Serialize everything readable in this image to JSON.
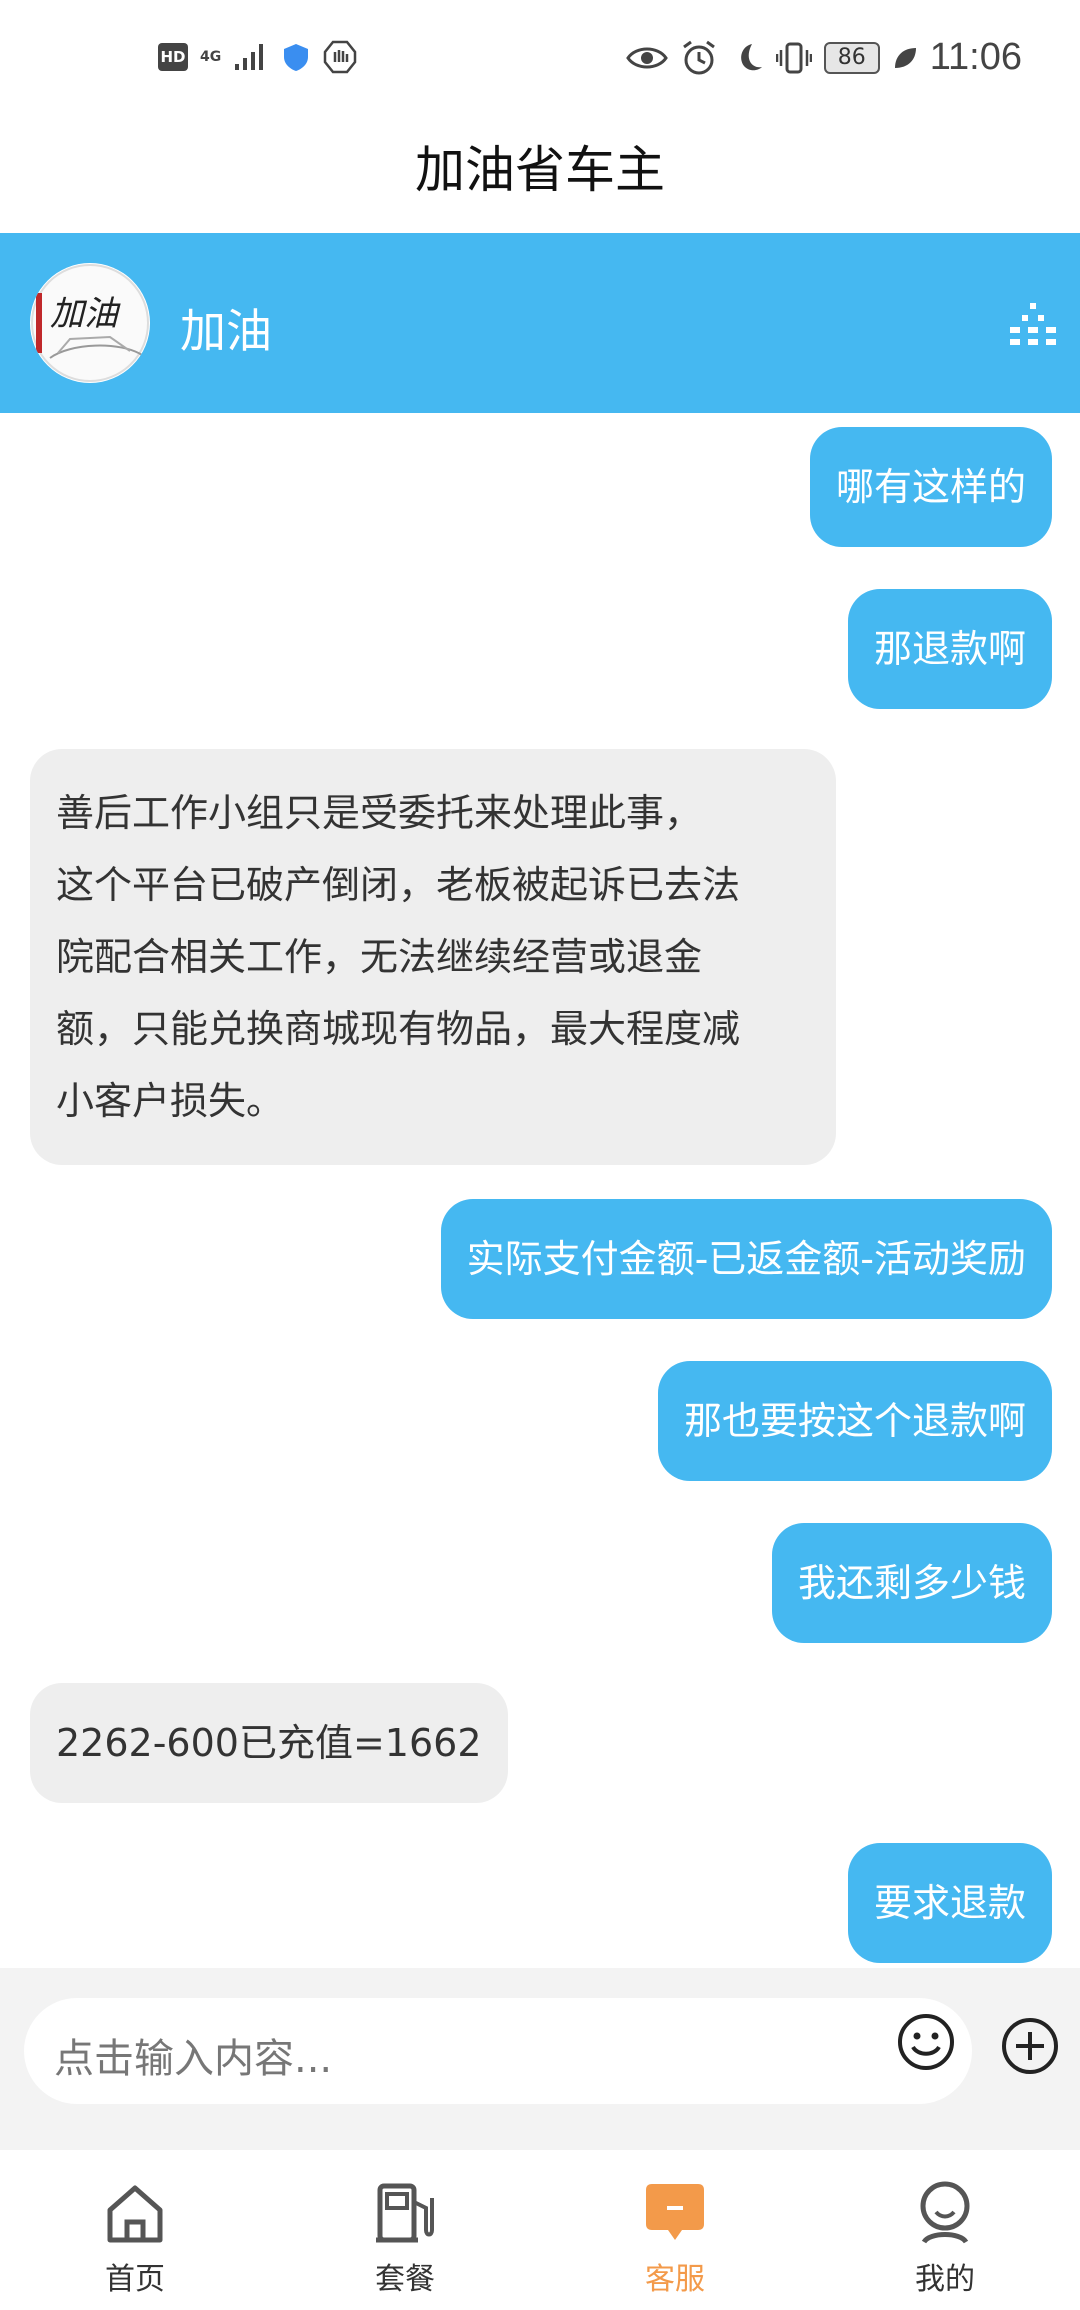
{
  "status_bar": {
    "hd": "HD",
    "network": "4G",
    "battery": "86",
    "time": "11:06"
  },
  "app": {
    "title": "加油省车主"
  },
  "chat_header": {
    "name": "加油",
    "avatar_text": "加油"
  },
  "messages": [
    {
      "side": "out",
      "text": "哪有这样的"
    },
    {
      "side": "out",
      "text": "那退款啊"
    },
    {
      "side": "in",
      "lines": [
        "善后工作小组只是受委托来处理此事，",
        "这个平台已破产倒闭，老板被起诉已去法",
        "院配合相关工作，无法继续经营或退金",
        "额，只能兑换商城现有物品，最大程度减",
        "小客户损失。"
      ]
    },
    {
      "side": "out",
      "text": "实际支付金额-已返金额-活动奖励"
    },
    {
      "side": "out",
      "text": "那也要按这个退款啊"
    },
    {
      "side": "out",
      "text": "我还剩多少钱"
    },
    {
      "side": "in",
      "text": "2262-600已充值=1662"
    },
    {
      "side": "out",
      "text": "要求退款"
    }
  ],
  "input": {
    "placeholder": "点击输入内容..."
  },
  "bottom_nav": {
    "items": [
      {
        "label": "首页",
        "icon": "home-icon"
      },
      {
        "label": "套餐",
        "icon": "fuel-pump-icon"
      },
      {
        "label": "客服",
        "icon": "chat-icon"
      },
      {
        "label": "我的",
        "icon": "profile-icon"
      }
    ],
    "active": "客服"
  },
  "colors": {
    "accent": "#45b8f1",
    "active_tab": "#f39a4a",
    "incoming_bubble": "#eeeeee"
  }
}
